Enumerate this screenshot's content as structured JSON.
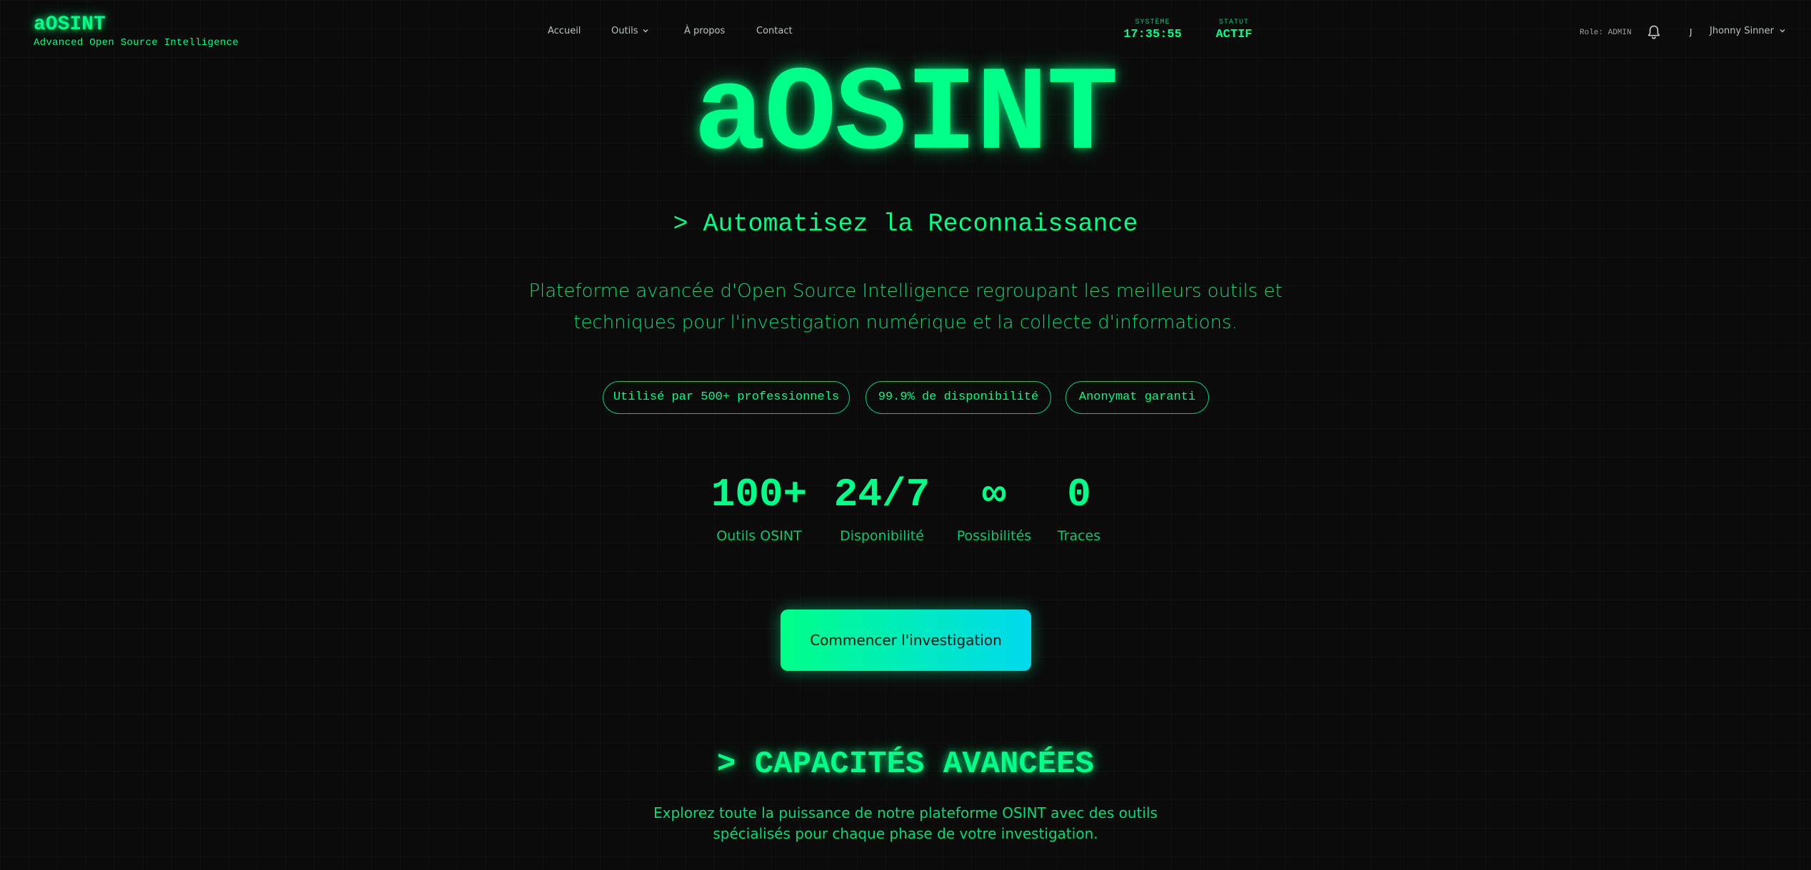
{
  "brand": {
    "name": "aOSINT",
    "tagline": "Advanced Open Source Intelligence"
  },
  "nav": {
    "items": [
      {
        "label": "Accueil"
      },
      {
        "label": "Outils"
      },
      {
        "label": "À propos"
      },
      {
        "label": "Contact"
      }
    ]
  },
  "system": {
    "time_label": "SYSTÈME",
    "time_value": "17:35:55",
    "status_label": "STATUT",
    "status_value": "ACTIF"
  },
  "user": {
    "role": "Role: ADMIN",
    "avatar_initial": "J",
    "name": "Jhonny Sinner"
  },
  "hero": {
    "title": "aOSINT",
    "subtitle": "> Automatisez la Reconnaissance",
    "description": "Plateforme avancée d'Open Source Intelligence regroupant les meilleurs outils et techniques pour l'investigation numérique et la collecte d'informations.",
    "badges": [
      "Utilisé par 500+ professionnels",
      "99.9% de disponibilité",
      "Anonymat garanti"
    ],
    "stats": [
      {
        "value": "100+",
        "label": "Outils OSINT"
      },
      {
        "value": "24/7",
        "label": "Disponibilité"
      },
      {
        "value": "∞",
        "label": "Possibilités"
      },
      {
        "value": "0",
        "label": "Traces"
      }
    ],
    "cta_label": "Commencer l'investigation"
  },
  "capabilities": {
    "title": "> CAPACITÉS AVANCÉES",
    "description": "Explorez toute la puissance de notre plateforme OSINT avec des outils spécialisés pour chaque phase de votre investigation."
  },
  "colors": {
    "accent": "#00ff88",
    "accent_secondary": "#00d9ef",
    "background": "#0b0b0b"
  }
}
